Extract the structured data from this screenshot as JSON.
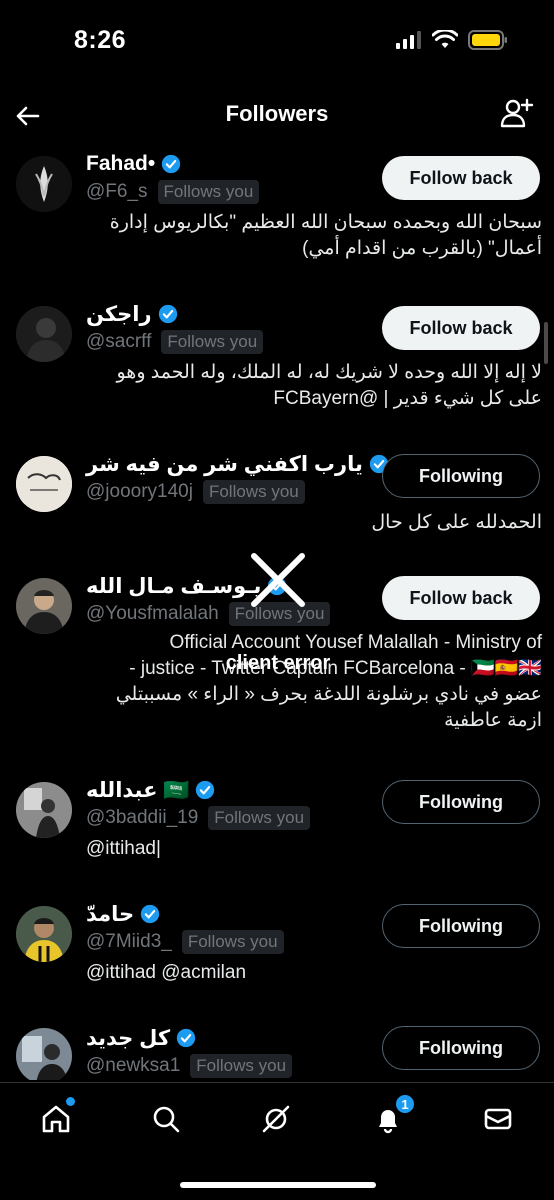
{
  "status_bar": {
    "time": "8:26"
  },
  "nav": {
    "title": "Followers"
  },
  "followers": [
    {
      "name": "Fahad•",
      "handle": "@F6_s",
      "follows_you": "Follows you",
      "button": "Follow back",
      "bio_lines": [
        "سبحان الله وبحمده سبحان الله العظيم \"بكالريوس إدارة",
        "أعمال\" (بالقرب من اقدام أمي)"
      ]
    },
    {
      "name": "راجكن",
      "handle": "@sacrff",
      "follows_you": "Follows you",
      "button": "Follow back",
      "bio_lines": [
        "لا إله إلا الله وحده لا شريك له، له الملك، وله الحمد وهو",
        "على كل شيء قدير | @FCBayern"
      ]
    },
    {
      "name": "يارب اكفني شر من فيه شر",
      "handle": "@jooory140j",
      "follows_you": "Follows you",
      "button": "Following",
      "bio_lines": [
        "الحمدلله على كل حال"
      ]
    },
    {
      "name": "يـوسـف مـال الله",
      "handle": "@Yousfmalalah",
      "follows_you": "Follows you",
      "button": "Follow back",
      "bio_lines": [
        "Official Account Yousef Malallah - Ministry of",
        "- justice - Twitter Captain FCBarcelona - 🇰🇼🇪🇸🇬🇧",
        "عضو في نادي برشلونة اللدغة بحرف « الراء » مسببتلي",
        "ازمة عاطفية"
      ]
    },
    {
      "name": "عبدالله 🇸🇦",
      "handle": "@3baddii_19",
      "follows_you": "Follows you",
      "button": "Following",
      "bio_lines": [
        "@ittihad|"
      ]
    },
    {
      "name": "حامدّ",
      "handle": "@7Miid3_",
      "follows_you": "Follows you",
      "button": "Following",
      "bio_lines": [
        "@ittihad @acmilan"
      ]
    },
    {
      "name": "كل جديد",
      "handle": "@newksa1",
      "follows_you": "Follows you",
      "button": "Following",
      "bio_lines": []
    }
  ],
  "error_overlay": {
    "text": "client error"
  },
  "tabbar": {
    "notification_count": "1",
    "items": [
      "home-icon",
      "search-icon",
      "grok-icon",
      "bell-icon",
      "mail-icon"
    ]
  },
  "colors": {
    "background": "#000000",
    "accent": "#1d9bf0",
    "muted": "#71767b",
    "follow_back_bg": "#eff3f4"
  }
}
